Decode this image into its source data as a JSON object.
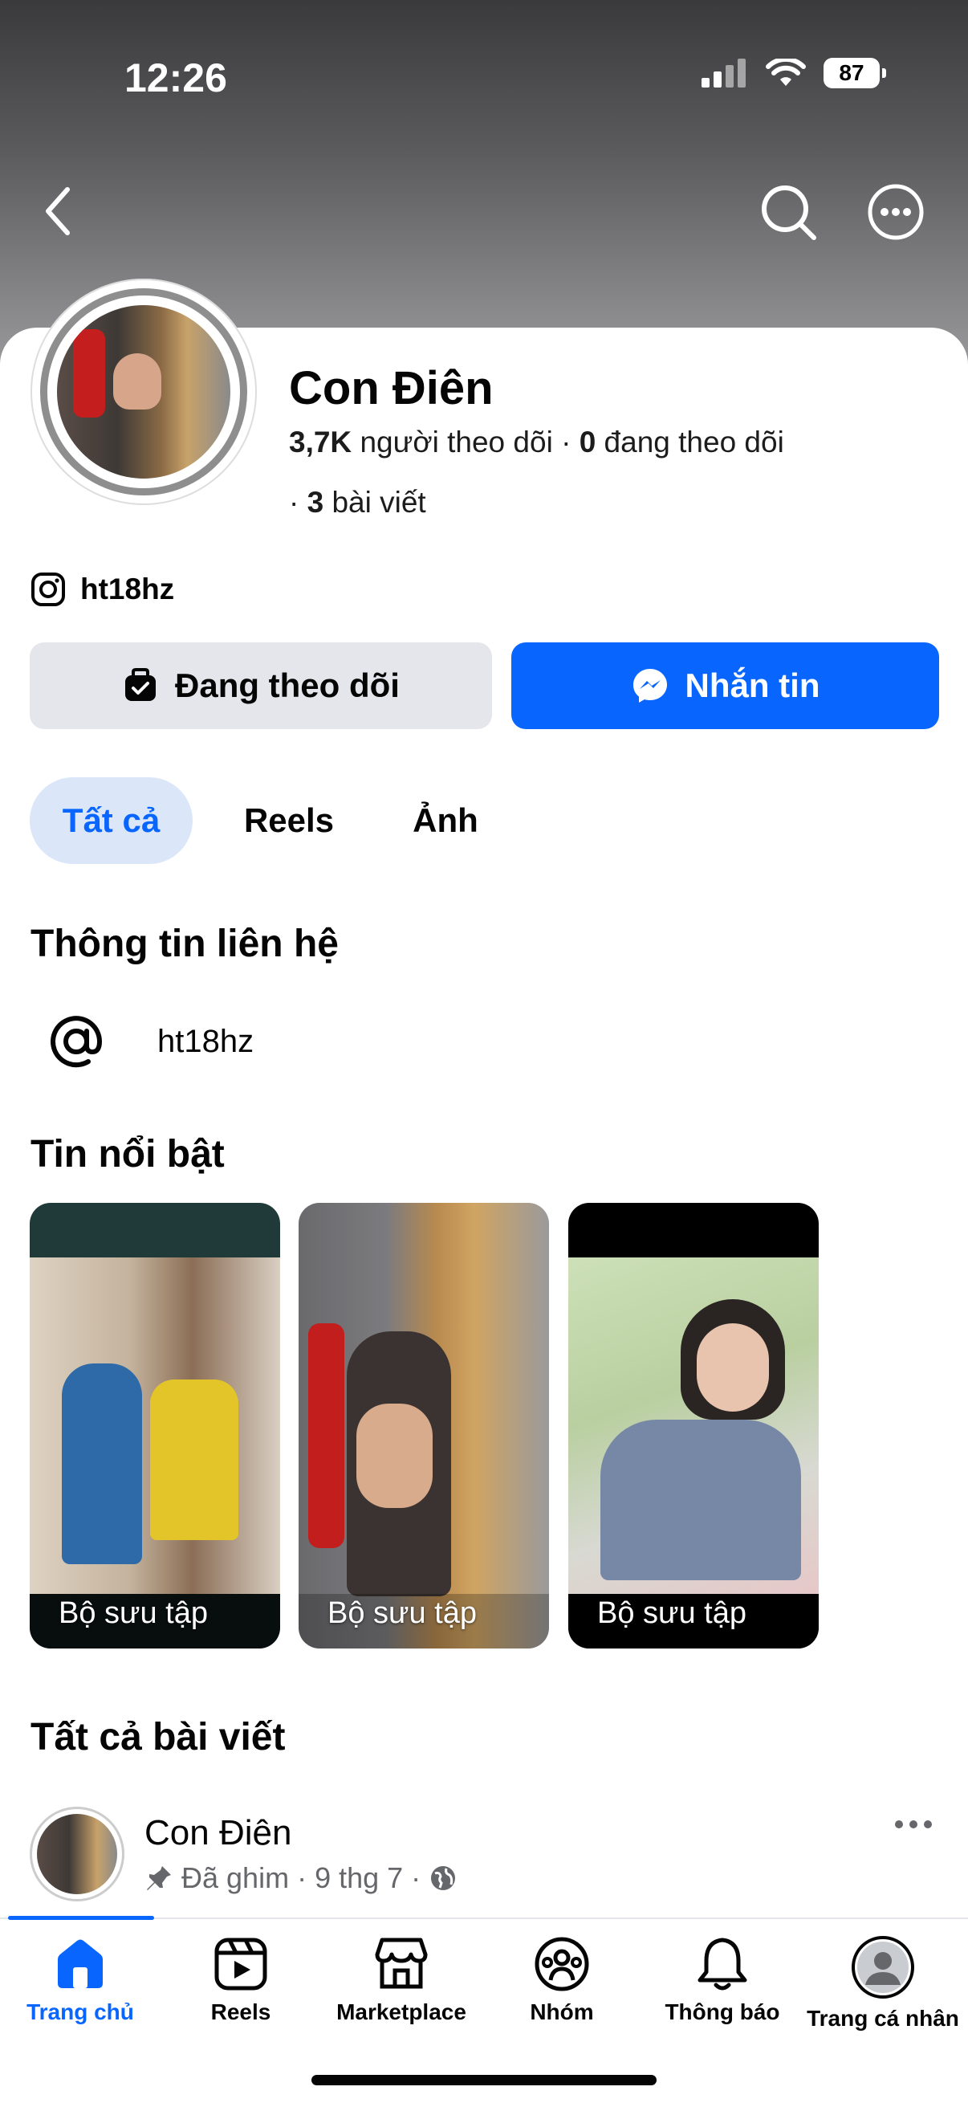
{
  "status_bar": {
    "time": "12:26",
    "battery": "87"
  },
  "profile": {
    "name": "Con Điên",
    "followers_count": "3,7K",
    "followers_label": "người theo dõi",
    "following_count": "0",
    "following_label": "đang theo dõi",
    "posts_count": "3",
    "posts_label": "bài viết",
    "instagram": "ht18hz"
  },
  "actions": {
    "follow_label": "Đang theo dõi",
    "message_label": "Nhắn tin"
  },
  "tabs": [
    {
      "label": "Tất cả",
      "active": true
    },
    {
      "label": "Reels",
      "active": false
    },
    {
      "label": "Ảnh",
      "active": false
    }
  ],
  "contact": {
    "title": "Thông tin liên hệ",
    "handle": "ht18hz"
  },
  "highlights": {
    "title": "Tin nổi bật",
    "items": [
      {
        "label": "Bộ sưu tập"
      },
      {
        "label": "Bộ sưu tập"
      },
      {
        "label": "Bộ sưu tập"
      }
    ]
  },
  "posts": {
    "title": "Tất cả bài viết",
    "first": {
      "author": "Con Điên",
      "pinned": "Đã ghim",
      "date": "9 thg 7"
    }
  },
  "bottom_nav": [
    {
      "label": "Trang chủ",
      "icon": "home-icon",
      "active": true
    },
    {
      "label": "Reels",
      "icon": "reels-icon",
      "active": false
    },
    {
      "label": "Marketplace",
      "icon": "marketplace-icon",
      "active": false
    },
    {
      "label": "Nhóm",
      "icon": "groups-icon",
      "active": false
    },
    {
      "label": "Thông báo",
      "icon": "bell-icon",
      "active": false
    },
    {
      "label": "Trang cá nhân",
      "icon": "profile-icon",
      "active": false
    }
  ],
  "colors": {
    "accent": "#0866ff",
    "secondary_button": "#e4e6eb",
    "active_tab_bg": "#dbe7f9"
  }
}
